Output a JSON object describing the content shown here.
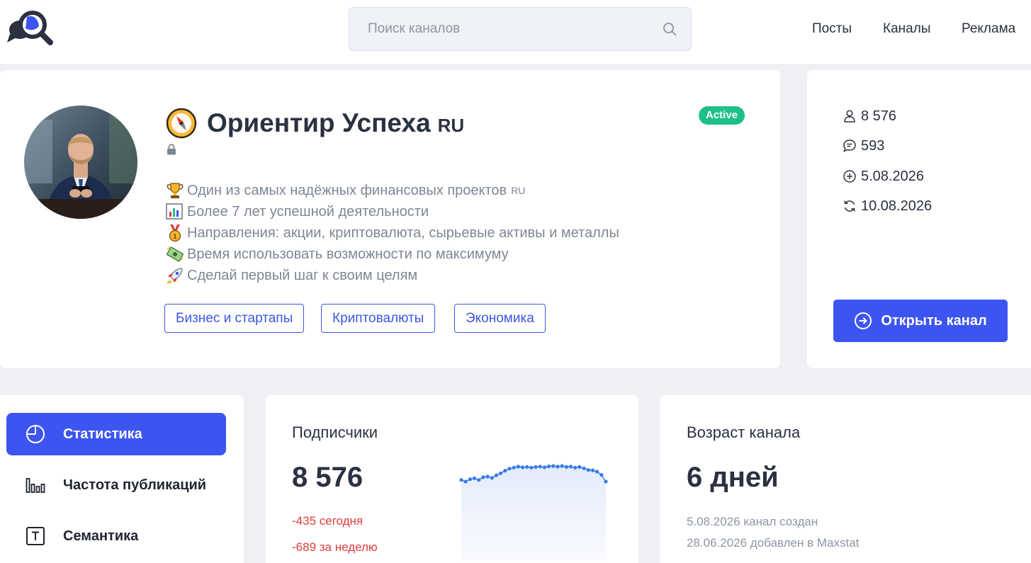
{
  "header": {
    "search_placeholder": "Поиск каналов",
    "nav": [
      "Посты",
      "Каналы",
      "Реклама"
    ]
  },
  "channel": {
    "title_emoji_icon": "compass-icon",
    "title": "Ориентир Успеха",
    "title_suffix": "RU",
    "status": "Active",
    "description": [
      {
        "icon": "trophy-icon",
        "text": "Один из самых надёжных финансовых проектов",
        "suffix": "RU"
      },
      {
        "icon": "bar-chart-icon",
        "text": "Более 7 лет успешной деятельности",
        "suffix": ""
      },
      {
        "icon": "medal-icon",
        "text": "Направления: акции, криптовалюта, сырьевые активы и металлы",
        "suffix": ""
      },
      {
        "icon": "money-icon",
        "text": "Время использовать возможности по максимуму",
        "suffix": ""
      },
      {
        "icon": "rocket-icon",
        "text": "Сделай первый шаг к своим целям",
        "suffix": ""
      }
    ],
    "tags": [
      "Бизнес и стартапы",
      "Криптовалюты",
      "Экономика"
    ]
  },
  "stats": {
    "subscribers": "8 576",
    "comments": "593",
    "created": "5.08.2026",
    "updated": "10.08.2026",
    "open_button": "Открыть канал"
  },
  "sidebar": {
    "items": [
      {
        "label": "Статистика",
        "icon": "pie-chart-icon",
        "active": true
      },
      {
        "label": "Частота публикаций",
        "icon": "bar-chart-icon",
        "active": false
      },
      {
        "label": "Семантика",
        "icon": "text-icon",
        "active": false
      }
    ]
  },
  "subscribers_card": {
    "title": "Подписчики",
    "value": "8 576",
    "today": "-435 сегодня",
    "week": "-689 за неделю",
    "sparkline": [
      8990,
      8985,
      8992,
      8995,
      8990,
      8998,
      9000,
      8996,
      9004,
      9010,
      9018,
      9024,
      9027,
      9030,
      9028,
      9029,
      9027,
      9029,
      9030,
      9028,
      9031,
      9032,
      9030,
      9032,
      9029,
      9030,
      9027,
      9029,
      9025,
      9020,
      9019,
      9015,
      9005,
      8985
    ]
  },
  "age_card": {
    "title": "Возраст канала",
    "value": "6 дней",
    "created_line": "5.08.2026 канал создан",
    "added_line": "28.06.2026 добавлен в Maxstat"
  },
  "colors": {
    "accent": "#3d55f0",
    "active_badge": "#1fbf8b",
    "negative": "#e23b3b",
    "sparkline": "#3a7be6"
  }
}
